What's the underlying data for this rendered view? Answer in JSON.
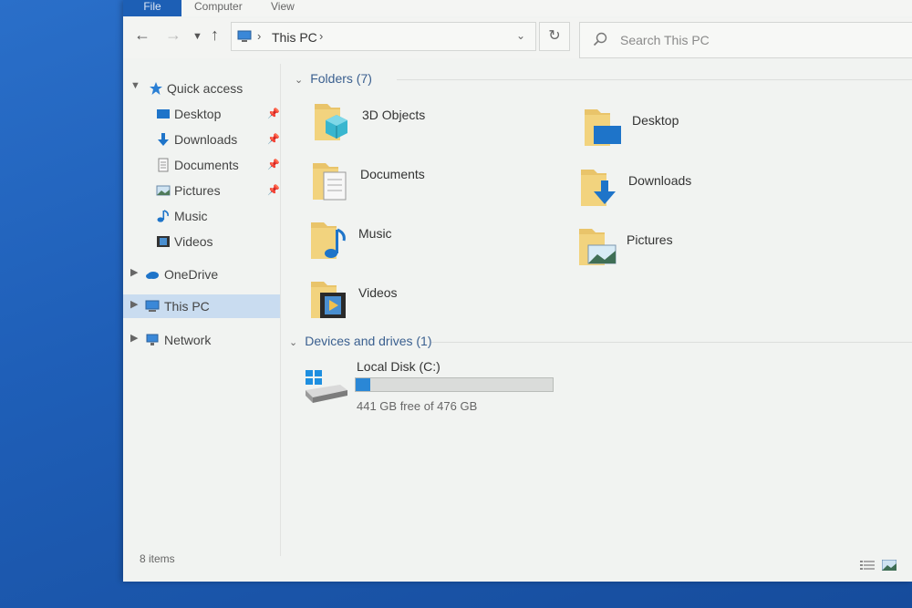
{
  "ribbon": {
    "tabs": [
      "File",
      "Computer",
      "View"
    ]
  },
  "nav": {
    "back_icon": "arrow-left",
    "forward_icon": "arrow-right",
    "up_icon": "arrow-up",
    "address": "This PC",
    "search_placeholder": "Search This PC"
  },
  "sidebar": {
    "quick_access": "Quick access",
    "quick_items": [
      {
        "label": "Desktop"
      },
      {
        "label": "Downloads"
      },
      {
        "label": "Documents"
      },
      {
        "label": "Pictures"
      },
      {
        "label": "Music"
      },
      {
        "label": "Videos"
      }
    ],
    "onedrive": "OneDrive",
    "this_pc": "This PC",
    "network": "Network"
  },
  "content": {
    "folders_header": "Folders (7)",
    "folders": [
      {
        "label": "3D Objects"
      },
      {
        "label": "Desktop"
      },
      {
        "label": "Documents"
      },
      {
        "label": "Downloads"
      },
      {
        "label": "Music"
      },
      {
        "label": "Pictures"
      },
      {
        "label": "Videos"
      }
    ],
    "devices_header": "Devices and drives (1)",
    "drive": {
      "name": "Local Disk (C:)",
      "free_text": "441 GB free of 476 GB",
      "used_fraction": 0.074
    }
  },
  "status": {
    "item_count": "8 items"
  },
  "colors": {
    "accent": "#1d5fb5",
    "folder": "#e9c46a",
    "drive_bar": "#2a87d6",
    "selection": "#c9dcf0"
  }
}
